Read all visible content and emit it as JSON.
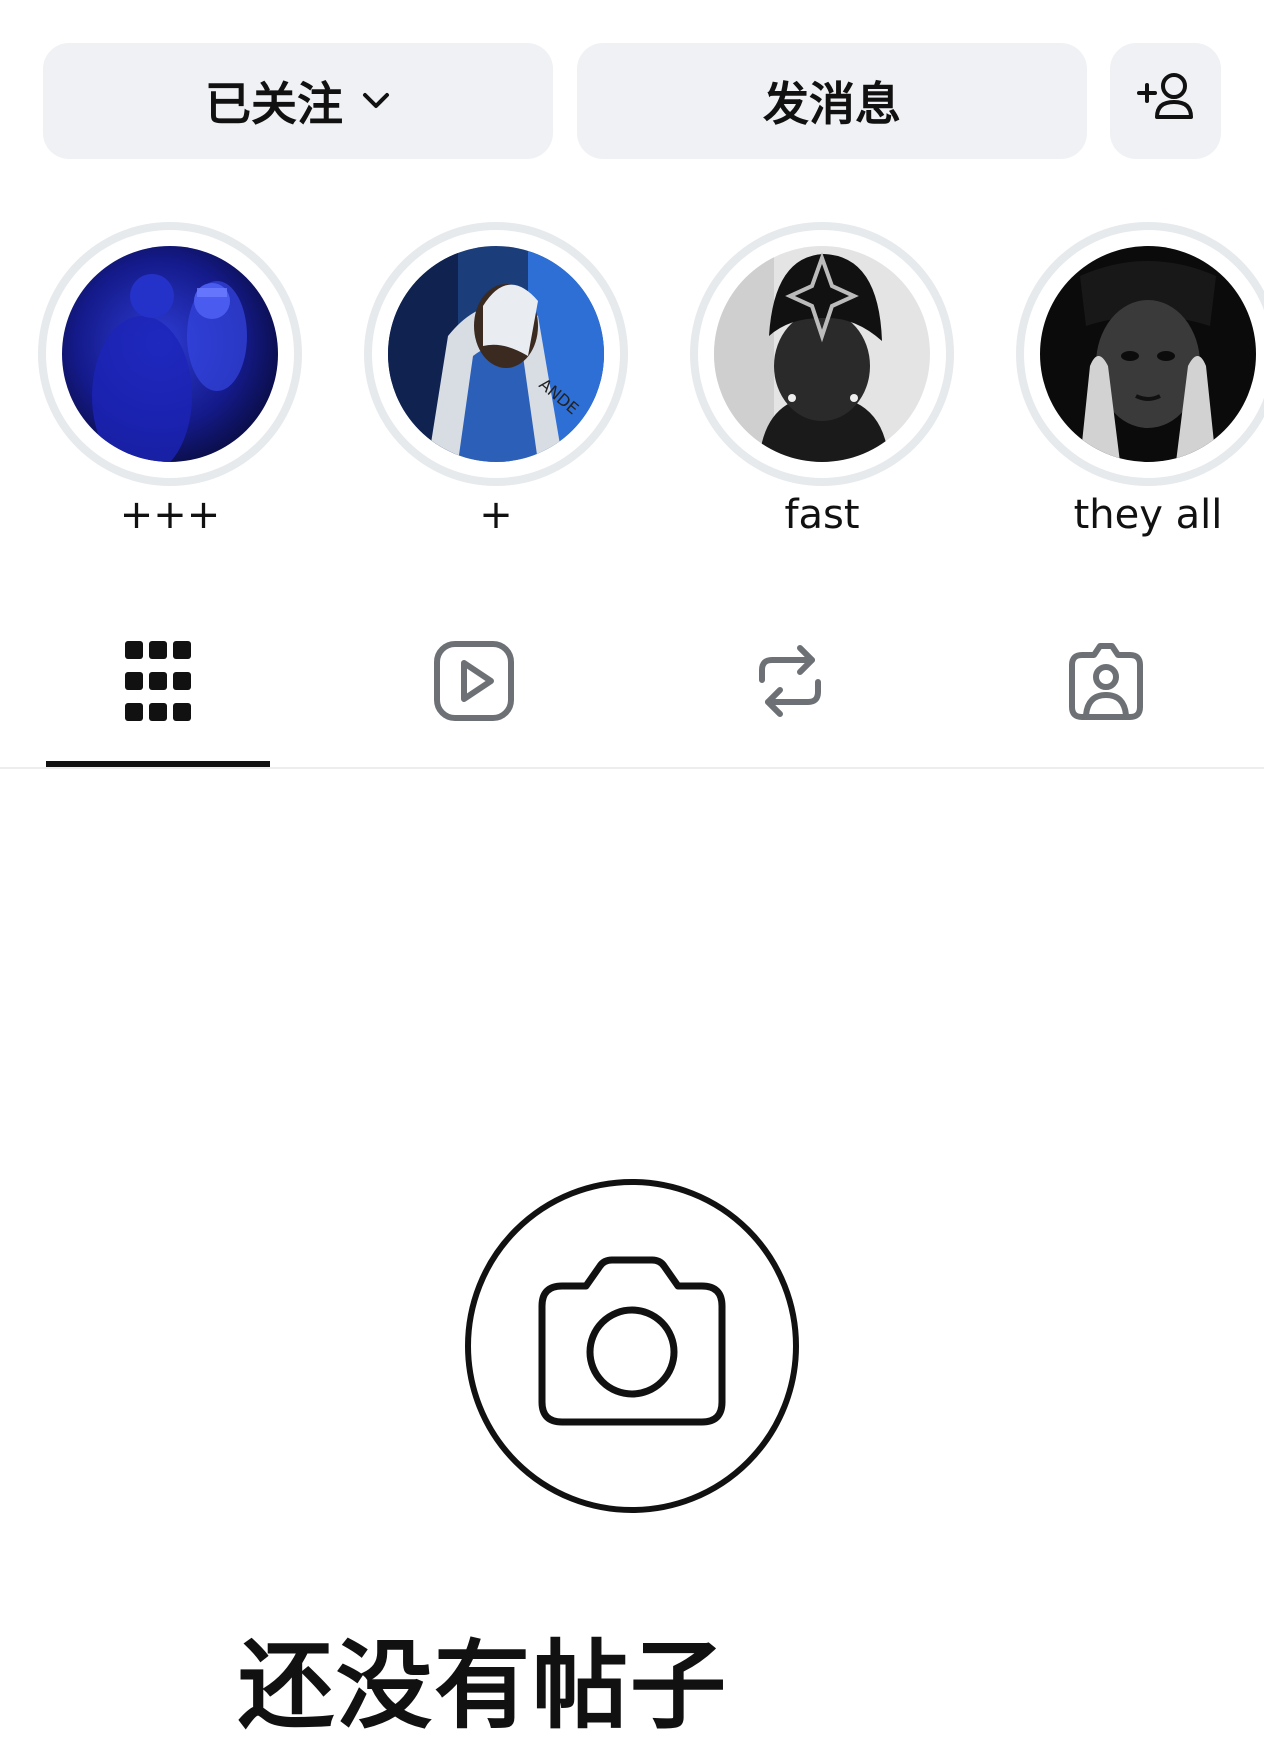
{
  "actions": {
    "following_label": "已关注",
    "message_label": "发消息"
  },
  "icons": {
    "following_dropdown": "chevron-down-icon",
    "suggest_people": "add-person-icon",
    "posts_tab": "grid-icon",
    "reels_tab": "reels-play-icon",
    "reposts_tab": "repost-icon",
    "tagged_tab": "tagged-person-icon",
    "empty_state": "camera-icon"
  },
  "highlights": [
    {
      "label": "+++"
    },
    {
      "label": "+"
    },
    {
      "label": "fast"
    },
    {
      "label": "they all"
    }
  ],
  "tabs": {
    "active": "posts"
  },
  "empty_state": {
    "title": "还没有帖子"
  },
  "colors": {
    "button_bg": "#eff1f4",
    "ring": "#e6eaed",
    "text": "#111111",
    "icon_inactive": "#6d7175"
  }
}
